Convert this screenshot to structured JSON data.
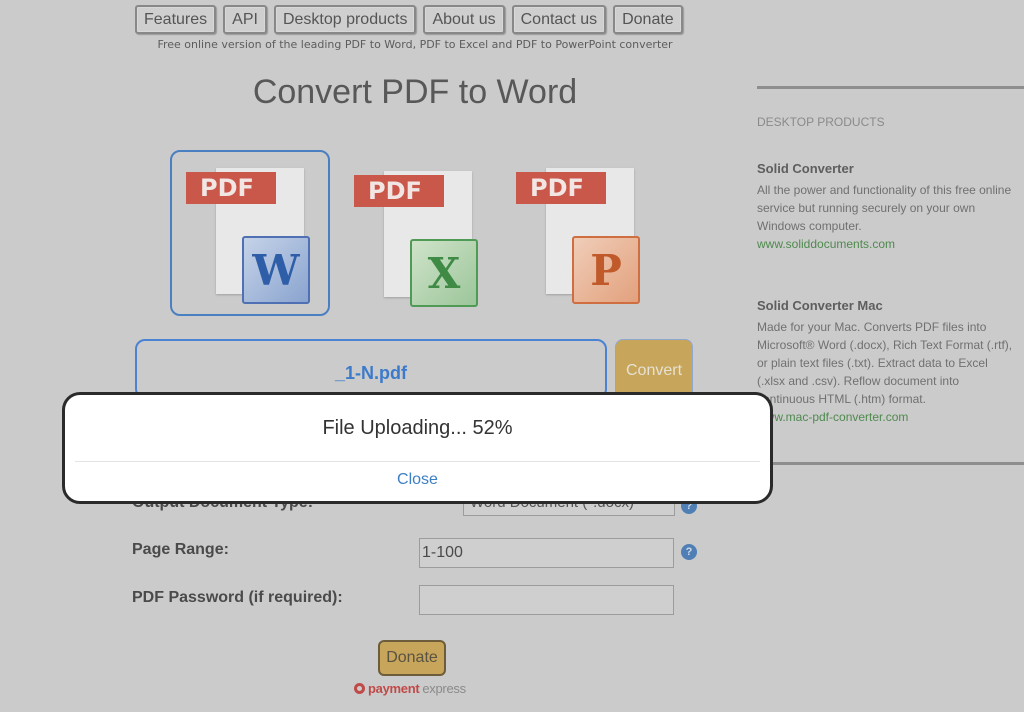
{
  "nav": {
    "items": [
      "Features",
      "API",
      "Desktop products",
      "About us",
      "Contact us",
      "Donate"
    ],
    "tagline": "Free online version of the leading PDF to Word, PDF to Excel and PDF to PowerPoint converter"
  },
  "main": {
    "title": "Convert PDF to Word",
    "formats": [
      {
        "tag": "PDF",
        "app_letter": "W",
        "target": "Word",
        "selected": true
      },
      {
        "tag": "PDF",
        "app_letter": "X",
        "target": "Excel",
        "selected": false
      },
      {
        "tag": "PDF",
        "app_letter": "P",
        "target": "PowerPoint",
        "selected": false
      }
    ],
    "file_name": "_1-N.pdf",
    "convert_label": "Convert",
    "form": {
      "output_type_label": "Output Document Type:",
      "output_type_value": "Word Document (*.docx)",
      "page_range_label": "Page Range:",
      "page_range_value": "1-100",
      "password_label": "PDF Password (if required):",
      "password_value": "",
      "help_glyph": "?"
    },
    "donate_label": "Donate",
    "payment_brand_a": "payment",
    "payment_brand_b": "express"
  },
  "sidebar": {
    "heading": "DESKTOP PRODUCTS",
    "products": [
      {
        "name": "Solid Converter",
        "description": "All the power and functionality of this free online service but running securely on your own Windows computer.",
        "link": "www.soliddocuments.com"
      },
      {
        "name": "Solid Converter Mac",
        "description": "Made for your Mac. Converts PDF files into Microsoft® Word (.docx), Rich Text Format (.rtf), or plain text files (.txt). Extract data to Excel (.xlsx and .csv). Reflow document into continuous HTML (.htm) format.",
        "link": "www.mac-pdf-converter.com"
      }
    ]
  },
  "modal": {
    "message": "File Uploading... 52%",
    "progress_percent": 52,
    "close_label": "Close"
  }
}
